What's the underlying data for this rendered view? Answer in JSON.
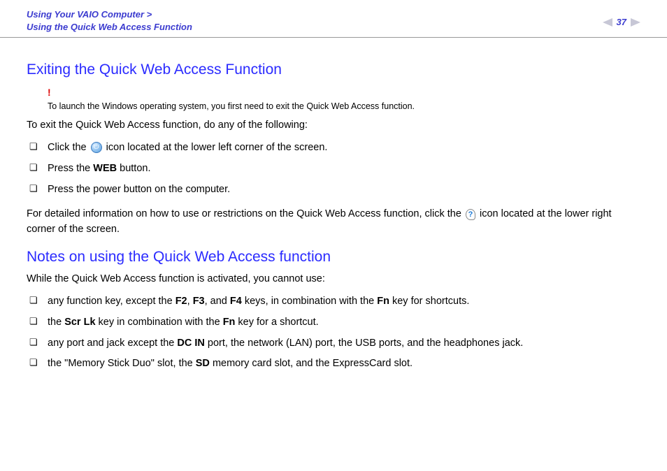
{
  "header": {
    "breadcrumb_line1": "Using Your VAIO Computer >",
    "breadcrumb_line2": "Using the Quick Web Access Function",
    "page_number": "37"
  },
  "section1": {
    "heading": "Exiting the Quick Web Access Function",
    "alert_mark": "!",
    "alert_text": "To launch the Windows operating system, you first need to exit the Quick Web Access function.",
    "intro": "To exit the Quick Web Access function, do any of the following:",
    "items": {
      "i0_pre": "Click the ",
      "i0_post": " icon located at the lower left corner of the screen.",
      "i1_pre": "Press the ",
      "i1_bold": "WEB",
      "i1_post": " button.",
      "i2": "Press the power button on the computer."
    },
    "followup_pre": "For detailed information on how to use or restrictions on the Quick Web Access function, click the ",
    "followup_post": " icon located at the lower right corner of the screen."
  },
  "section2": {
    "heading": "Notes on using the Quick Web Access function",
    "intro": "While the Quick Web Access function is activated, you cannot use:",
    "items": {
      "i0_a": "any function key, except the ",
      "i0_b1": "F2",
      "i0_c": ", ",
      "i0_b2": "F3",
      "i0_d": ", and ",
      "i0_b3": "F4",
      "i0_e": " keys, in combination with the ",
      "i0_b4": "Fn",
      "i0_f": " key for shortcuts.",
      "i1_a": "the ",
      "i1_b1": "Scr Lk",
      "i1_c": " key in combination with the ",
      "i1_b2": "Fn",
      "i1_d": " key for a shortcut.",
      "i2_a": "any port and jack except the ",
      "i2_b1": "DC IN",
      "i2_c": " port, the network (LAN) port, the USB ports, and the headphones jack.",
      "i3_a": "the \"Memory Stick Duo\" slot, the ",
      "i3_b1": "SD",
      "i3_c": " memory card slot, and the ExpressCard slot."
    }
  }
}
